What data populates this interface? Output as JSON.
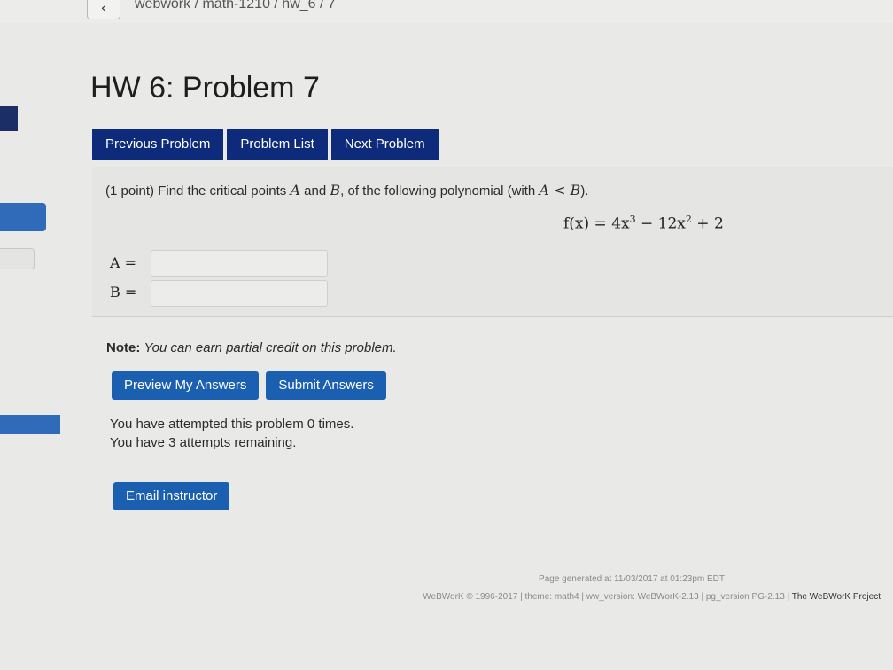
{
  "breadcrumb": "webwork / math-1210 / hw_6 / 7",
  "back_icon": "‹",
  "page_title": "HW 6: Problem 7",
  "nav": {
    "previous": "Previous Problem",
    "list": "Problem List",
    "next": "Next Problem"
  },
  "problem": {
    "points": "(1 point) Find the critical points",
    "var_a": "A",
    "and": "and",
    "var_b": "B",
    "rest": ", of the following polynomial (with",
    "condition": "A < B",
    "close": ").",
    "formula": {
      "lhs": "f(x) = 4x",
      "exp1": "3",
      "mid": " − 12x",
      "exp2": "2",
      "tail": " + 2"
    },
    "answer_a_label": "A =",
    "answer_b_label": "B =",
    "answer_a_value": "",
    "answer_b_value": ""
  },
  "note_label": "Note:",
  "note_text": "You can earn partial credit on this problem.",
  "actions": {
    "preview": "Preview My Answers",
    "submit": "Submit Answers"
  },
  "attempts": {
    "line1": "You have attempted this problem 0 times.",
    "line2": "You have 3 attempts remaining."
  },
  "email_button": "Email instructor",
  "footer": {
    "generated": "Page generated at 11/03/2017 at 01:23pm EDT",
    "copyright": "WeBWorK © 1996-2017 | theme: math4 | ww_version: WeBWorK-2.13 | pg_version PG-2.13 |",
    "project": "The WeBWorK Project"
  },
  "colors": {
    "nav_button": "#0d2b7a",
    "action_button": "#1a5fb0",
    "background": "#e9e9e7"
  }
}
